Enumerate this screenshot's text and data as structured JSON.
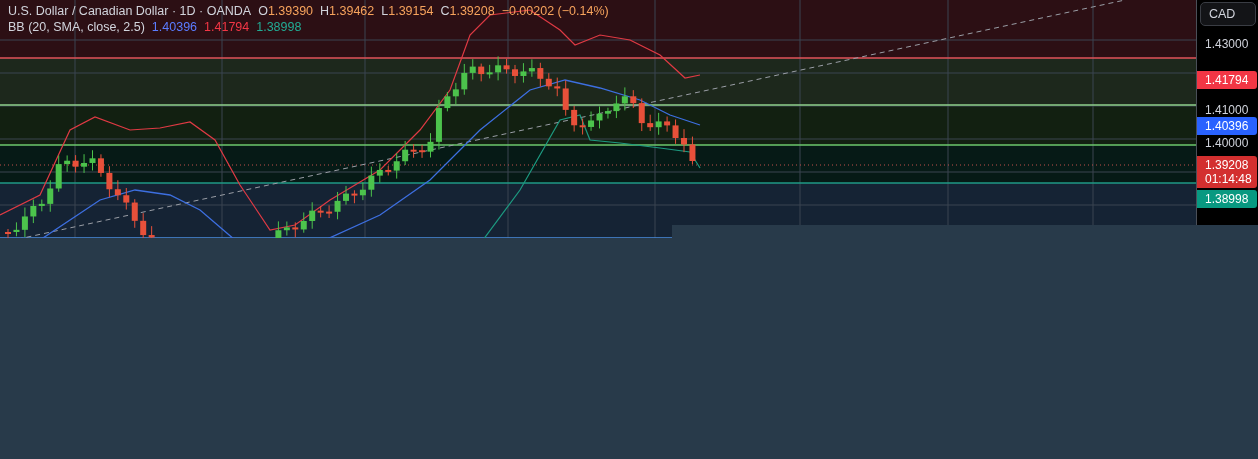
{
  "symbol": {
    "title": "U.S. Dollar / Canadian Dollar · 1D · OANDA",
    "ohlc": [
      {
        "label": "O",
        "value": "1.39390"
      },
      {
        "label": "H",
        "value": "1.39462"
      },
      {
        "label": "L",
        "value": "1.39154"
      },
      {
        "label": "C",
        "value": "1.39208"
      }
    ],
    "change": "−0.00202 (−0.14%)"
  },
  "indicator": {
    "name": "BB (20, SMA, close, 2.5)",
    "values": [
      {
        "value": "1.40396",
        "color": "#5b7cff"
      },
      {
        "value": "1.41794",
        "color": "#f23645"
      },
      {
        "value": "1.38998",
        "color": "#22ab94"
      }
    ]
  },
  "price_axis": {
    "currency": "CAD",
    "ticks": [
      "1.43000",
      "1.41000",
      "1.40000"
    ],
    "badges": [
      {
        "value": "1.41794",
        "color": "#f23645"
      },
      {
        "value": "1.40396",
        "color": "#2962ff"
      },
      {
        "value": "1.39208",
        "countdown": "01:14:48",
        "color": "#d32f2f"
      },
      {
        "value": "1.38998",
        "color": "#089981"
      }
    ]
  }
}
